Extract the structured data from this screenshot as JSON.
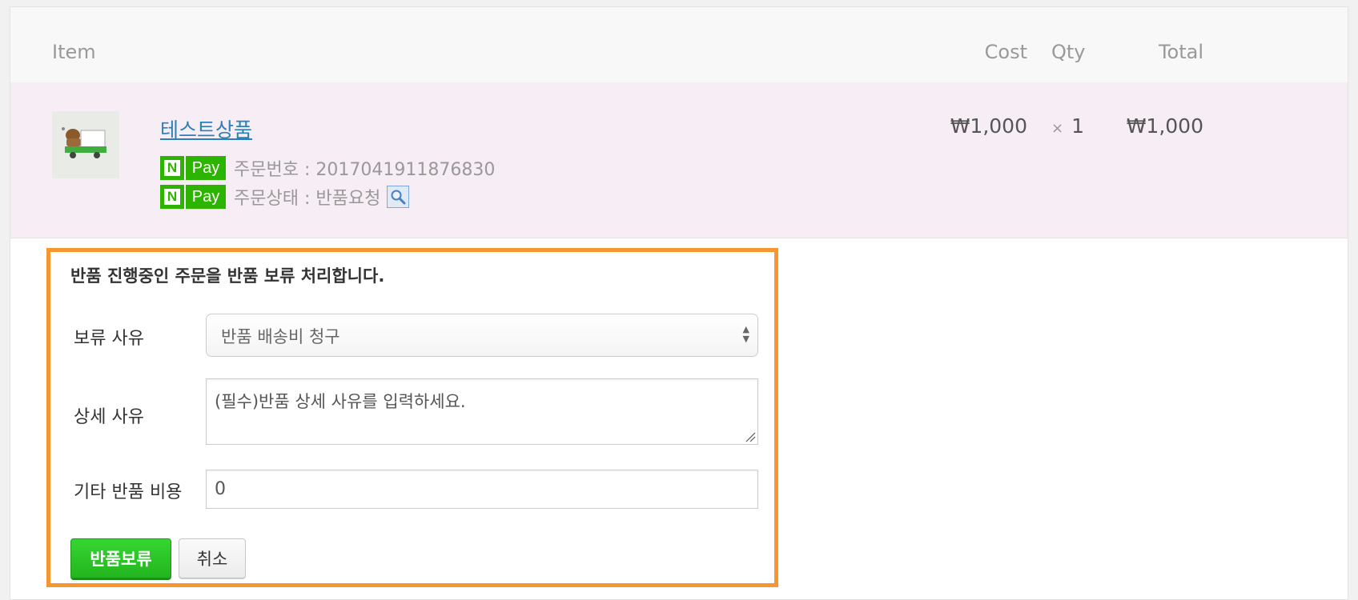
{
  "table": {
    "headers": {
      "item": "Item",
      "cost": "Cost",
      "qty": "Qty",
      "total": "Total"
    },
    "row": {
      "product_name": "테스트상품",
      "npay_n": "N",
      "npay_pay": "Pay",
      "order_number_text": "주문번호 : 2017041911876830",
      "order_status_text": "주문상태 : 반품요청",
      "cost": "₩1,000",
      "qty_prefix": "×",
      "qty": "1",
      "total": "₩1,000"
    }
  },
  "form": {
    "title": "반품 진행중인 주문을 반품 보류 처리합니다.",
    "reason_label": "보류 사유",
    "reason_selected": "반품 배송비 청구",
    "detail_label": "상세 사유",
    "detail_placeholder": "(필수)반품 상세 사유를 입력하세요.",
    "cost_label": "기타 반품 비용",
    "cost_value": "0",
    "submit_label": "반품보류",
    "cancel_label": "취소"
  },
  "colors": {
    "highlight_border": "#f7962f",
    "row_background": "#f6edf5",
    "npay_green": "#2db400",
    "submit_green": "#22b51f",
    "link_blue": "#2a80b9"
  },
  "icons": {
    "product_thumbnail": "delivery-truck-thumbnail",
    "order_status_lookup": "magnifier-icon",
    "select_arrows": "updown-arrows-icon",
    "resize": "resize-grip-icon"
  }
}
